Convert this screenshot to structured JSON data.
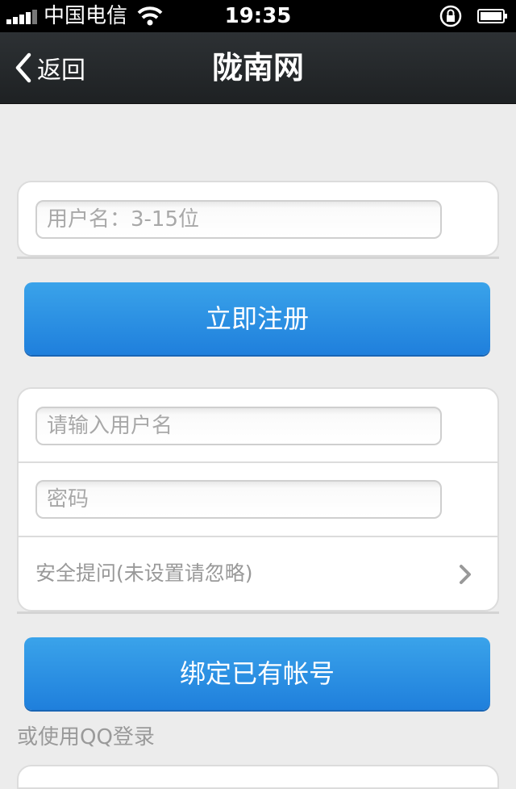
{
  "status_bar": {
    "carrier": "中国电信",
    "time": "19:35"
  },
  "nav": {
    "back_label": "返回",
    "title": "陇南网"
  },
  "register": {
    "username_placeholder": "用户名：3-15位",
    "submit_label": "立即注册"
  },
  "bind": {
    "username_placeholder": "请输入用户名",
    "password_placeholder": "密码",
    "security_question_label": "安全提问(未设置请忽略)",
    "submit_label": "绑定已有帐号"
  },
  "qq_login_label": "或使用QQ登录",
  "colors": {
    "primary_button": "#2a8fe4",
    "nav_background": "#25292b"
  }
}
